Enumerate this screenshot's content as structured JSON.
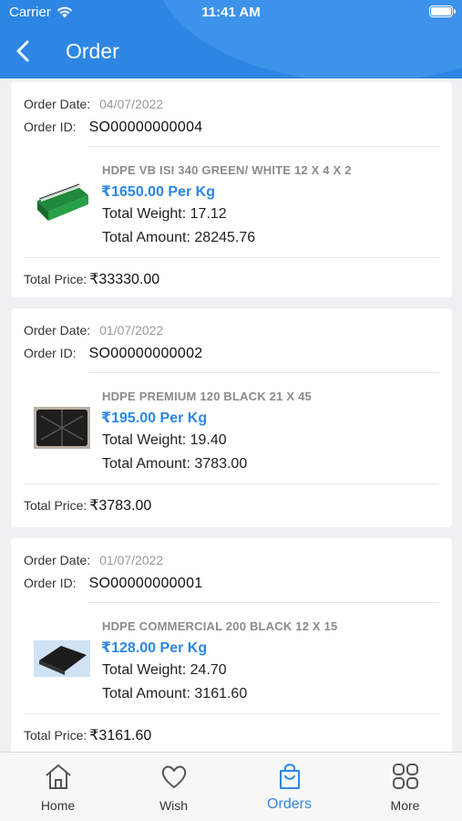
{
  "status": {
    "carrier": "Carrier",
    "time": "11:41 AM"
  },
  "header": {
    "title": "Order"
  },
  "labels": {
    "order_date": "Order Date:",
    "order_id": "Order ID:",
    "total_weight": "Total Weight:",
    "total_amount": "Total Amount:",
    "total_price": "Total Price:",
    "per_unit": "Per Kg"
  },
  "orders": [
    {
      "date": "04/07/2022",
      "id": "SO00000000004",
      "product": "HDPE VB ISI 340 GREEN/ WHITE 12 X 4 X 2",
      "price": "₹1650.00 Per Kg",
      "weight": "Total Weight: 17.12",
      "amount": "Total Amount: 28245.76",
      "total_price": "₹33330.00",
      "thumb": "green-bag-icon"
    },
    {
      "date": "01/07/2022",
      "id": "SO00000000002",
      "product": "HDPE PREMIUM 120 BLACK 21 X 45",
      "price": "₹195.00 Per Kg",
      "weight": "Total Weight: 19.40",
      "amount": "Total Amount: 3783.00",
      "total_price": "₹3783.00",
      "thumb": "black-sheet-icon"
    },
    {
      "date": "01/07/2022",
      "id": "SO00000000001",
      "product": "HDPE COMMERCIAL 200 BLACK 12 X 15",
      "price": "₹128.00 Per Kg",
      "weight": "Total Weight: 24.70",
      "amount": "Total Amount: 3161.60",
      "total_price": "₹3161.60",
      "thumb": "black-tarp-icon"
    }
  ],
  "tabs": [
    {
      "label": "Home",
      "icon": "home-icon"
    },
    {
      "label": "Wish",
      "icon": "heart-icon"
    },
    {
      "label": "Orders",
      "icon": "shopping-bag-icon",
      "active": true
    },
    {
      "label": "More",
      "icon": "grid-icon"
    }
  ],
  "colors": {
    "primary": "#2d86e3",
    "background": "#f0f0f2"
  }
}
